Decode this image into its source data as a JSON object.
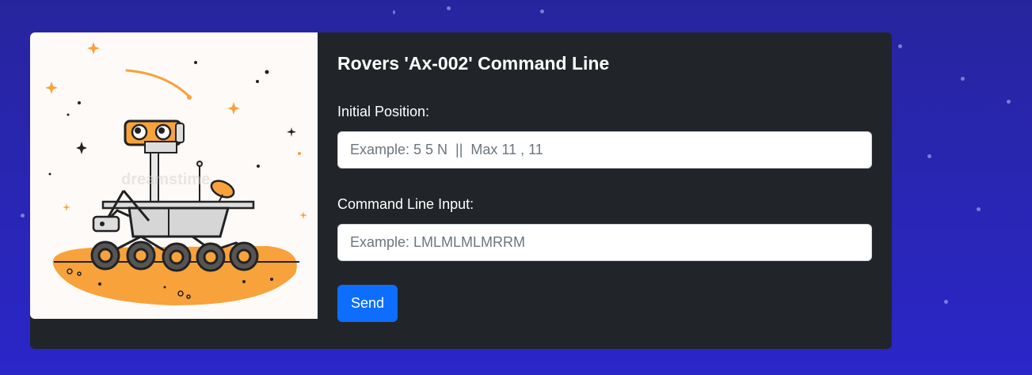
{
  "form": {
    "title": "Rovers 'Ax-002' Command Line",
    "initial_position": {
      "label": "Initial Position:",
      "placeholder": "Example: 5 5 N  ||  Max 11 , 11",
      "value": ""
    },
    "command_line": {
      "label": "Command Line Input:",
      "placeholder": "Example: LMLMLMLMRRM",
      "value": ""
    },
    "send_label": "Send"
  },
  "colors": {
    "background": "#2a26c8",
    "card": "#212529",
    "button": "#0d6efd",
    "rover_accent": "#f7a23b"
  },
  "image": {
    "subject": "rover-illustration",
    "watermark": "dreamstime"
  }
}
